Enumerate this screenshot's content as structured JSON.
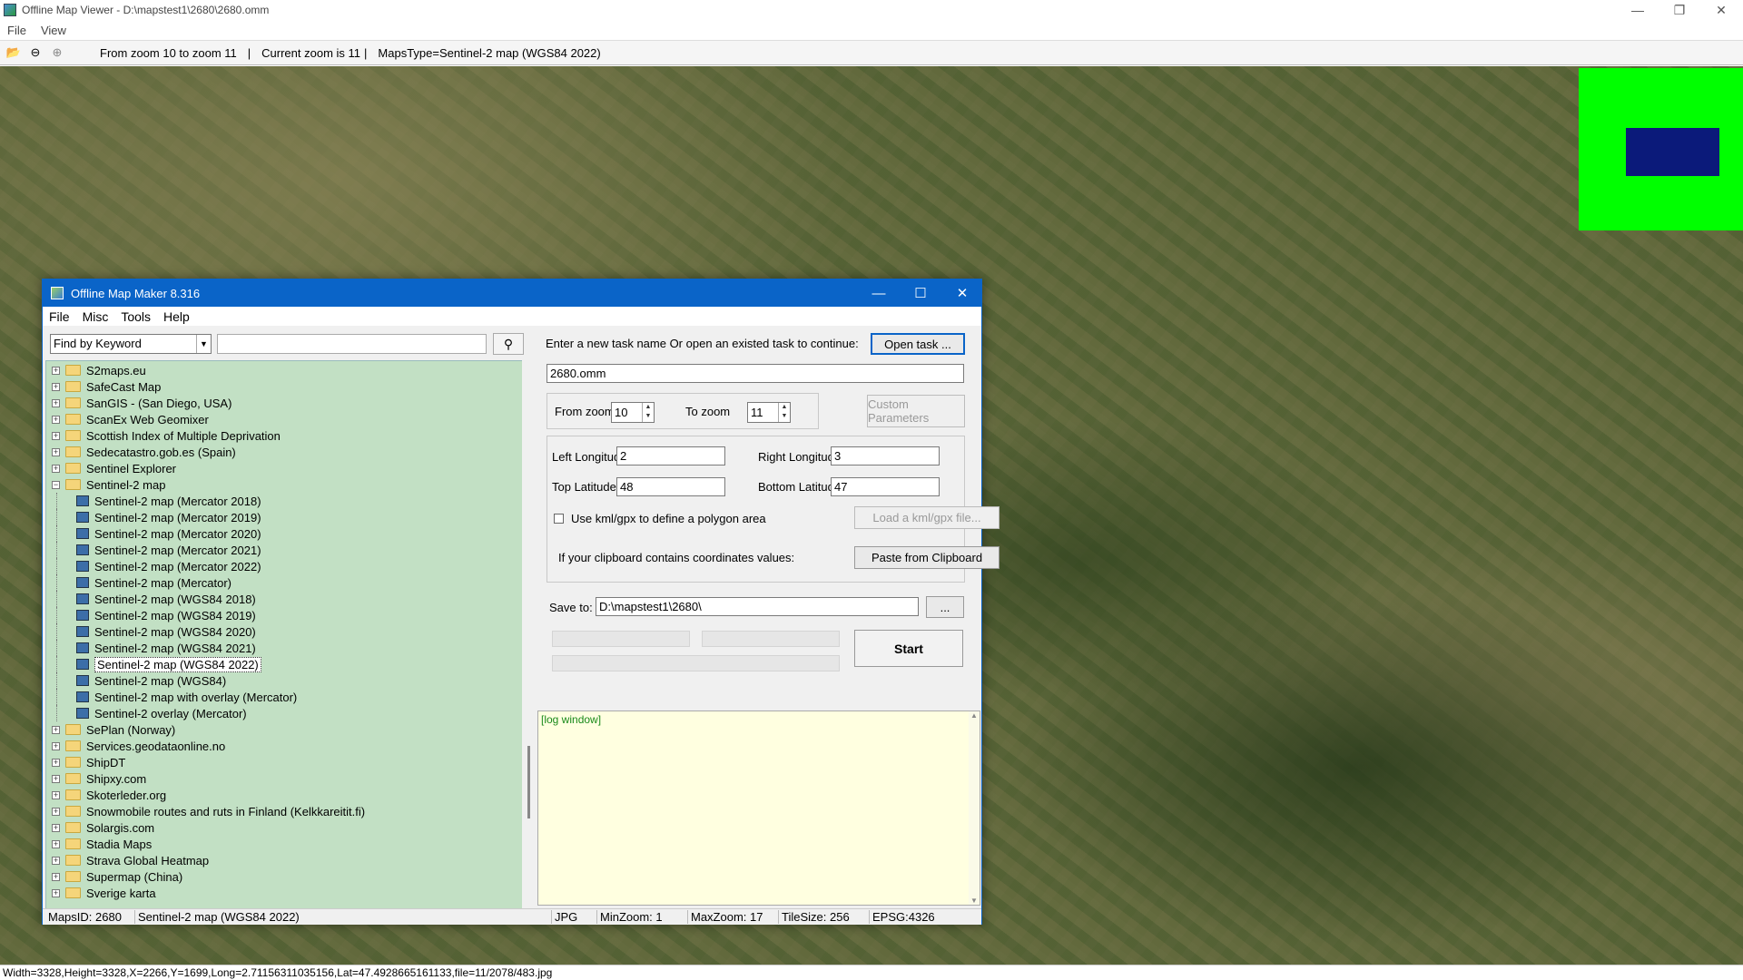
{
  "window": {
    "title": "Offline Map Viewer - D:\\mapstest1\\2680\\2680.omm"
  },
  "menu": [
    "File",
    "View"
  ],
  "toolbar": {
    "zoom_range": "From zoom 10 to zoom 11",
    "sep": "|",
    "current_zoom": "Current zoom is 11",
    "maps_type": "MapsType=Sentinel-2 map (WGS84 2022)"
  },
  "statusbar": "Width=3328,Height=3328,X=2266,Y=1699,Long=2.71156311035156,Lat=47.4928665161133,file=11/2078/483.jpg",
  "dialog": {
    "title": "Offline Map Maker 8.316",
    "menu": [
      "File",
      "Misc",
      "Tools",
      "Help"
    ],
    "search": {
      "mode": "Find by Keyword",
      "value": ""
    },
    "tree": [
      {
        "label": "S2maps.eu",
        "type": "folder"
      },
      {
        "label": "SafeCast Map",
        "type": "folder"
      },
      {
        "label": "SanGIS - (San Diego, USA)",
        "type": "folder"
      },
      {
        "label": "ScanEx Web Geomixer",
        "type": "folder"
      },
      {
        "label": "Scottish Index of Multiple Deprivation",
        "type": "folder"
      },
      {
        "label": "Sedecatastro.gob.es (Spain)",
        "type": "folder"
      },
      {
        "label": "Sentinel Explorer",
        "type": "folder"
      },
      {
        "label": "Sentinel-2 map",
        "type": "open"
      },
      {
        "label": "Sentinel-2 map (Mercator 2018)",
        "type": "leaf"
      },
      {
        "label": "Sentinel-2 map (Mercator 2019)",
        "type": "leaf"
      },
      {
        "label": "Sentinel-2 map (Mercator 2020)",
        "type": "leaf"
      },
      {
        "label": "Sentinel-2 map (Mercator 2021)",
        "type": "leaf"
      },
      {
        "label": "Sentinel-2 map (Mercator 2022)",
        "type": "leaf"
      },
      {
        "label": "Sentinel-2 map (Mercator)",
        "type": "leaf"
      },
      {
        "label": "Sentinel-2 map (WGS84 2018)",
        "type": "leaf"
      },
      {
        "label": "Sentinel-2 map (WGS84 2019)",
        "type": "leaf"
      },
      {
        "label": "Sentinel-2 map (WGS84 2020)",
        "type": "leaf"
      },
      {
        "label": "Sentinel-2 map (WGS84 2021)",
        "type": "leaf"
      },
      {
        "label": "Sentinel-2 map (WGS84 2022)",
        "type": "leaf",
        "selected": true
      },
      {
        "label": "Sentinel-2 map (WGS84)",
        "type": "leaf"
      },
      {
        "label": "Sentinel-2 map with overlay (Mercator)",
        "type": "leaf"
      },
      {
        "label": "Sentinel-2 overlay (Mercator)",
        "type": "leaf"
      },
      {
        "label": "SePlan (Norway)",
        "type": "folder"
      },
      {
        "label": "Services.geodataonline.no",
        "type": "folder"
      },
      {
        "label": "ShipDT",
        "type": "folder"
      },
      {
        "label": "Shipxy.com",
        "type": "folder"
      },
      {
        "label": "Skoterleder.org",
        "type": "folder"
      },
      {
        "label": "Snowmobile routes and ruts in Finland (Kelkkareitit.fi)",
        "type": "folder"
      },
      {
        "label": "Solargis.com",
        "type": "folder"
      },
      {
        "label": "Stadia Maps",
        "type": "folder"
      },
      {
        "label": "Strava Global Heatmap",
        "type": "folder"
      },
      {
        "label": "Supermap (China)",
        "type": "folder"
      },
      {
        "label": "Sverige karta",
        "type": "folder"
      }
    ],
    "task_prompt": "Enter a new task name Or open an existed task to continue:",
    "open_task": "Open task ...",
    "task_name": "2680.omm",
    "from_zoom_label": "From zoom",
    "from_zoom": "10",
    "to_zoom_label": "To zoom",
    "to_zoom": "11",
    "custom_params": "Custom Parameters",
    "left_lon_label": "Left Longitude",
    "left_lon": "2",
    "right_lon_label": "Right Longitude",
    "right_lon": "3",
    "top_lat_label": "Top Latitude",
    "top_lat": "48",
    "bottom_lat_label": "Bottom Latitude",
    "bottom_lat": "47",
    "kml_label": "Use kml/gpx to define a polygon area",
    "load_kml": "Load a kml/gpx file...",
    "clipboard_label": "If your clipboard contains coordinates values:",
    "paste": "Paste from Clipboard",
    "save_label": "Save to:",
    "save_path": "D:\\mapstest1\\2680\\",
    "browse": "...",
    "start": "Start",
    "log": "[log window]",
    "status": {
      "mapsid": "MapsID: 2680",
      "name": "Sentinel-2 map (WGS84 2022)",
      "fmt": "JPG",
      "minzoom": "MinZoom: 1",
      "maxzoom": "MaxZoom: 17",
      "tilesize": "TileSize: 256",
      "epsg": "EPSG:4326"
    }
  },
  "colors": {
    "accent": "#0a64c8",
    "tree_bg": "#c2e0c4",
    "log_bg": "#ffffe0",
    "minimap_bg": "#00ff00",
    "minimap_view": "#0b1a7a"
  }
}
